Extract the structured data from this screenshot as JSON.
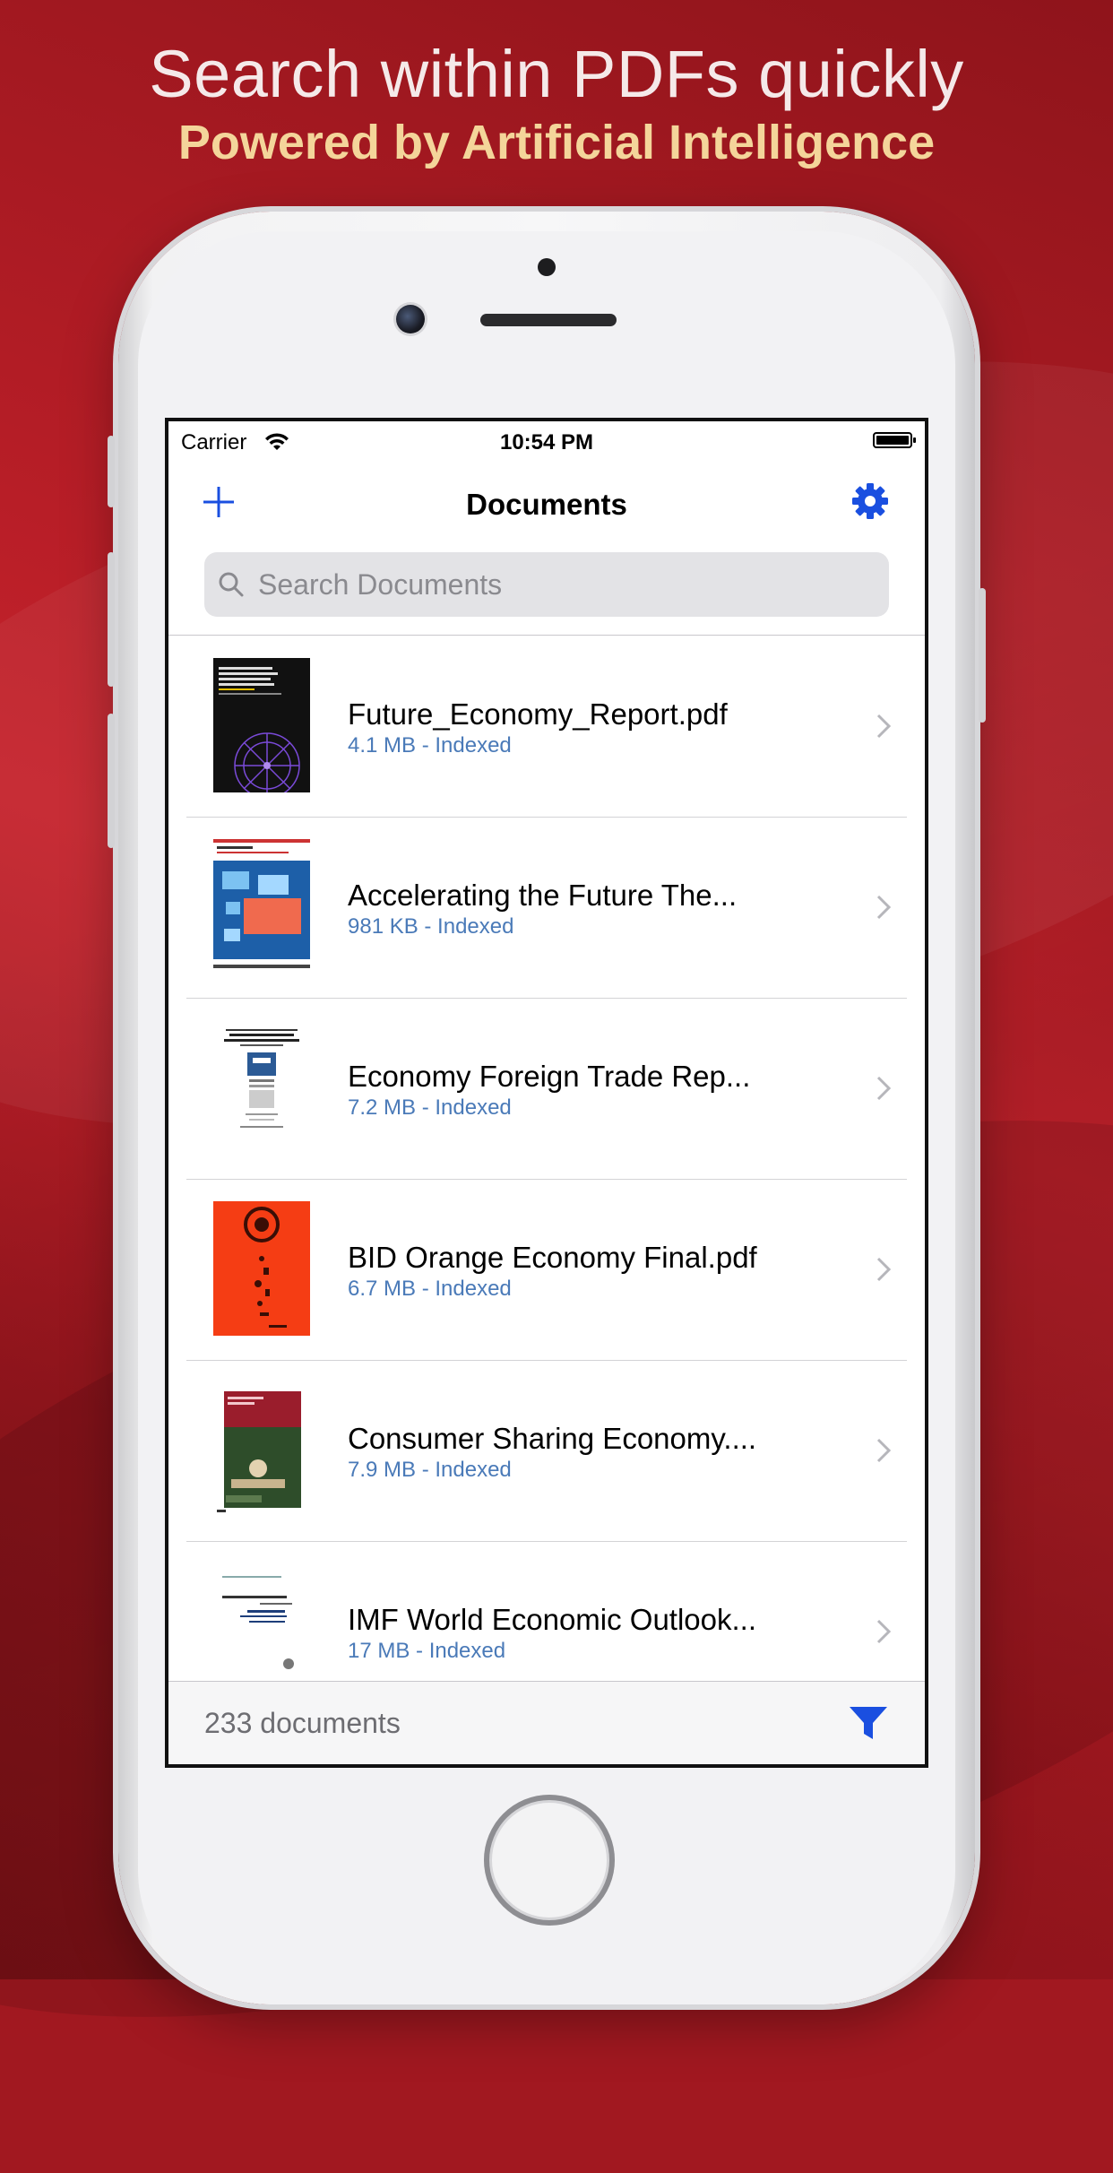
{
  "promo": {
    "headline": "Search within PDFs quickly",
    "subline": "Powered by Artificial Intelligence"
  },
  "statusbar": {
    "carrier": "Carrier",
    "time": "10:54 PM"
  },
  "navbar": {
    "title": "Documents",
    "add_icon": "plus-icon",
    "settings_icon": "gear-icon"
  },
  "search": {
    "placeholder": "Search Documents",
    "value": ""
  },
  "documents": [
    {
      "title": "Future_Economy_Report.pdf",
      "meta": "4.1 MB - Indexed",
      "thumb": "future-economy-cover"
    },
    {
      "title": "Accelerating the Future The...",
      "meta": "981 KB - Indexed",
      "thumb": "accelerating-future-cover"
    },
    {
      "title": "Economy Foreign Trade Rep...",
      "meta": "7.2 MB - Indexed",
      "thumb": "foreign-trade-cover"
    },
    {
      "title": "BID Orange Economy Final.pdf",
      "meta": "6.7 MB - Indexed",
      "thumb": "orange-economy-cover"
    },
    {
      "title": "Consumer Sharing Economy....",
      "meta": "7.9 MB - Indexed",
      "thumb": "sharing-economy-cover"
    },
    {
      "title": "IMF World Economic Outlook...",
      "meta": "17 MB - Indexed",
      "thumb": "imf-outlook-cover"
    }
  ],
  "footer": {
    "count_label": "233 documents",
    "filter_icon": "filter-icon"
  },
  "colors": {
    "accent": "#1a4fe0",
    "meta_text": "#4a7ab8",
    "background": "#a11820",
    "subline": "#f4d59a"
  }
}
